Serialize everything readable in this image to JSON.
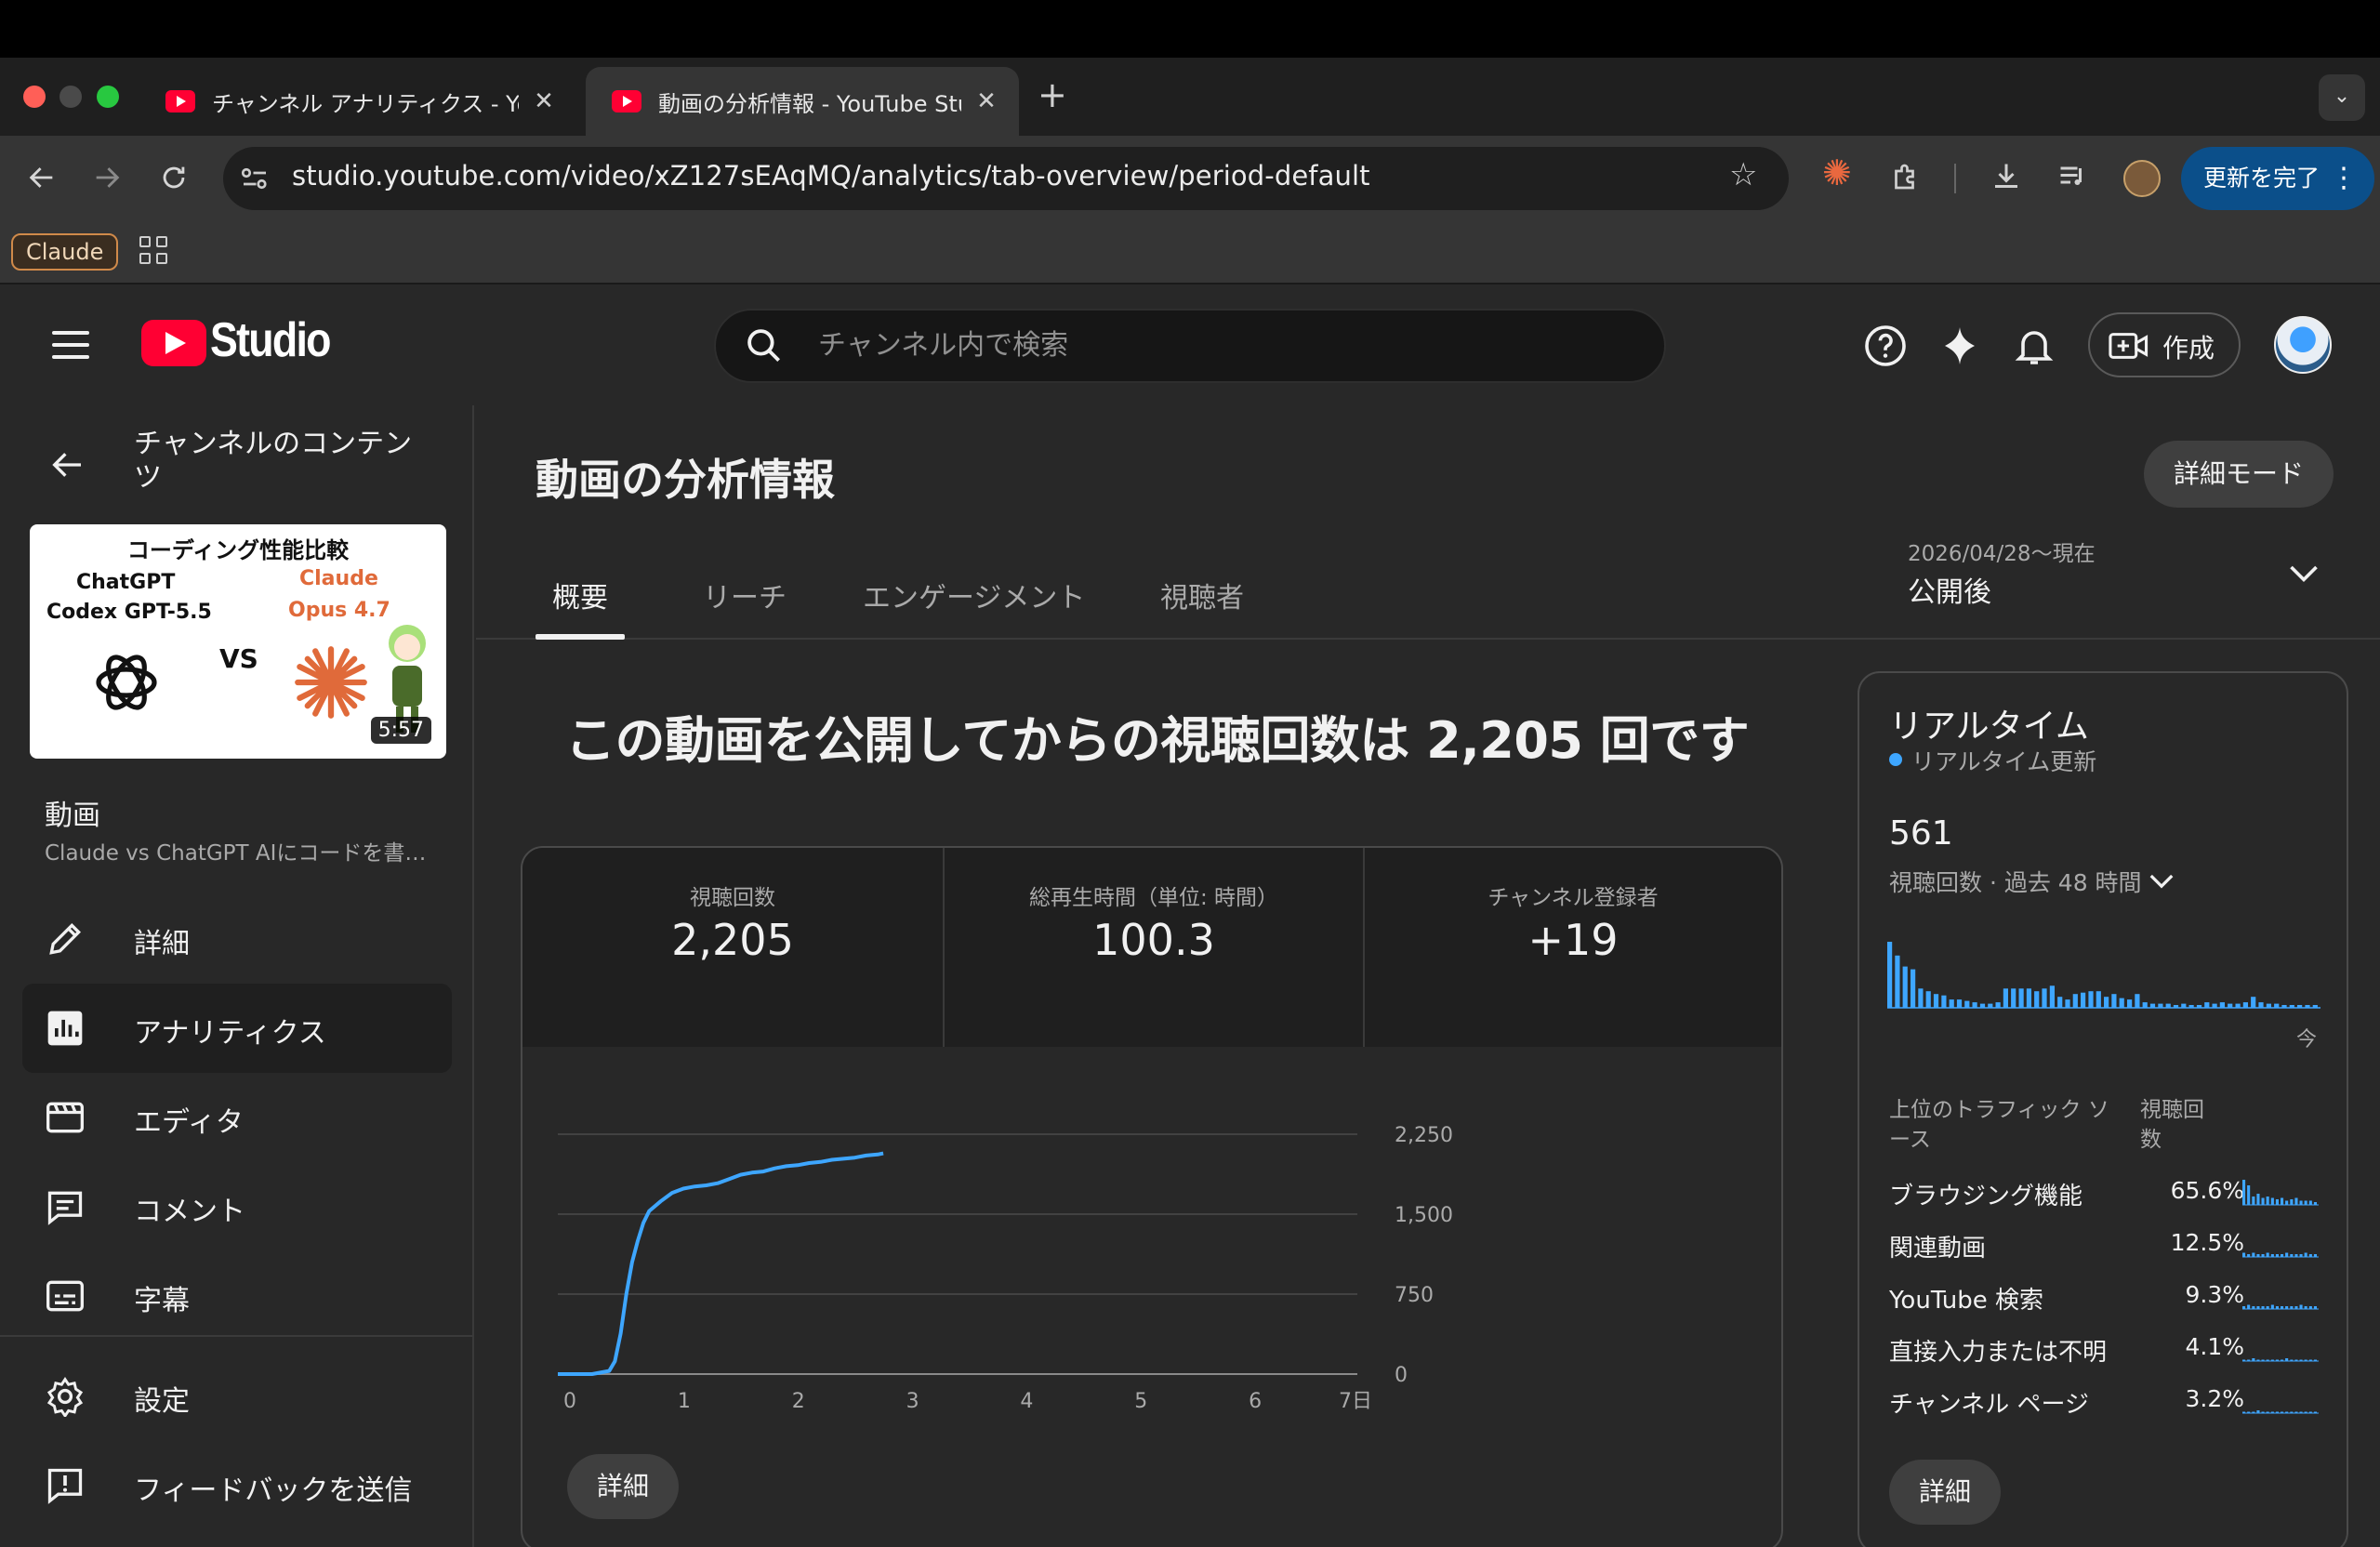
{
  "browser": {
    "tabs": [
      {
        "title": "チャンネル アナリティクス - YouTube Studio",
        "active": false
      },
      {
        "title": "動画の分析情報 - YouTube Studio",
        "active": true
      }
    ],
    "url": "studio.youtube.com/video/xZ127sEAqMQ/analytics/tab-overview/period-default",
    "update_button": "更新を完了",
    "bookmark_claude": "Claude"
  },
  "studio": {
    "logo_text": "Studio",
    "search_placeholder": "チャンネル内で検索",
    "create_label": "作成"
  },
  "sidebar": {
    "channel_content": "チャンネルのコンテンツ",
    "thumbnail": {
      "title": "コーディング性能比較",
      "left_line1": "ChatGPT",
      "left_line2": "Codex GPT-5.5",
      "vs": "VS",
      "right_line1": "Claude",
      "right_line2": "Opus 4.7",
      "duration": "5:57"
    },
    "video_label": "動画",
    "video_title": "Claude vs ChatGPT AIにコードを書…",
    "items": [
      {
        "label": "詳細",
        "icon": "pencil-icon",
        "active": false
      },
      {
        "label": "アナリティクス",
        "icon": "analytics-icon",
        "active": true
      },
      {
        "label": "エディタ",
        "icon": "editor-icon",
        "active": false
      },
      {
        "label": "コメント",
        "icon": "comment-icon",
        "active": false
      },
      {
        "label": "字幕",
        "icon": "subtitles-icon",
        "active": false
      },
      {
        "label": "設定",
        "icon": "gear-icon",
        "active": false
      },
      {
        "label": "フィードバックを送信",
        "icon": "feedback-icon",
        "active": false
      }
    ]
  },
  "main": {
    "title": "動画の分析情報",
    "advanced_mode": "詳細モード",
    "tabs": [
      "概要",
      "リーチ",
      "エンゲージメント",
      "視聴者"
    ],
    "date_range": "2026/04/28～現在",
    "date_label": "公開後",
    "headline": "この動画を公開してからの視聴回数は 2,205 回です",
    "metrics": [
      {
        "label": "視聴回数",
        "value": "2,205"
      },
      {
        "label": "総再生時間（単位: 時間）",
        "value": "100.3"
      },
      {
        "label": "チャンネル登録者",
        "value": "+19"
      }
    ],
    "details_button": "詳細"
  },
  "chart_data": {
    "type": "line",
    "x_ticks": [
      "0",
      "1",
      "2",
      "3",
      "4",
      "5",
      "6",
      "7日"
    ],
    "y_ticks": [
      "0",
      "750",
      "1,500",
      "2,250"
    ],
    "xlim": [
      0,
      7
    ],
    "ylim": [
      0,
      2250
    ],
    "x": [
      0,
      0.3,
      0.45,
      0.5,
      0.55,
      0.6,
      0.65,
      0.7,
      0.75,
      0.8,
      0.9,
      1.0,
      1.1,
      1.2,
      1.3,
      1.4,
      1.5,
      1.6,
      1.7,
      1.8,
      1.9,
      2.0,
      2.1,
      2.2,
      2.3,
      2.4,
      2.5,
      2.6,
      2.7,
      2.8,
      2.85
    ],
    "values": [
      0,
      0,
      30,
      120,
      380,
      750,
      1050,
      1250,
      1420,
      1530,
      1620,
      1700,
      1740,
      1760,
      1770,
      1790,
      1830,
      1870,
      1890,
      1900,
      1930,
      1950,
      1960,
      1980,
      1990,
      2010,
      2020,
      2030,
      2050,
      2060,
      2070
    ],
    "line_color": "#3ea6ff",
    "grid": true
  },
  "realtime": {
    "title": "リアルタイム",
    "subtitle": "リアルタイム更新",
    "count": "561",
    "count_label": "視聴回数 · 過去 48 時間",
    "now_label": "今",
    "bars": [
      48,
      38,
      30,
      28,
      14,
      12,
      10,
      9,
      6,
      6,
      5,
      4,
      3,
      3,
      4,
      14,
      14,
      14,
      14,
      12,
      14,
      16,
      8,
      6,
      10,
      11,
      12,
      12,
      8,
      10,
      7,
      6,
      10,
      4,
      3,
      3,
      3,
      2,
      3,
      2,
      2,
      4,
      3,
      4,
      3,
      3,
      4,
      8,
      4,
      3,
      3,
      2,
      2,
      2,
      2,
      2
    ],
    "bar_color": "#3ea6ff",
    "traffic_header_source": "上位のトラフィック ソース",
    "traffic_header_views": "視聴回数",
    "traffic": [
      {
        "name": "ブラウジング機能",
        "pct": "65.6%",
        "spark": [
          18,
          14,
          6,
          8,
          5,
          6,
          5,
          4,
          5,
          3,
          4,
          5,
          3,
          3,
          3,
          2
        ]
      },
      {
        "name": "関連動画",
        "pct": "12.5%",
        "spark": [
          3,
          2,
          3,
          2,
          2,
          3,
          2,
          2,
          2,
          3,
          2,
          2,
          2,
          3,
          2,
          2
        ]
      },
      {
        "name": "YouTube 検索",
        "pct": "9.3%",
        "spark": [
          2,
          3,
          2,
          2,
          2,
          2,
          3,
          2,
          2,
          2,
          2,
          2,
          3,
          2,
          2,
          2
        ]
      },
      {
        "name": "直接入力または不明",
        "pct": "4.1%",
        "spark": [
          1,
          1,
          2,
          1,
          1,
          1,
          1,
          1,
          1,
          2,
          1,
          1,
          1,
          1,
          1,
          1
        ]
      },
      {
        "name": "チャンネル ページ",
        "pct": "3.2%",
        "spark": [
          1,
          1,
          1,
          2,
          1,
          1,
          1,
          1,
          1,
          1,
          1,
          1,
          1,
          1,
          1,
          1
        ]
      }
    ],
    "details_button": "詳細"
  }
}
